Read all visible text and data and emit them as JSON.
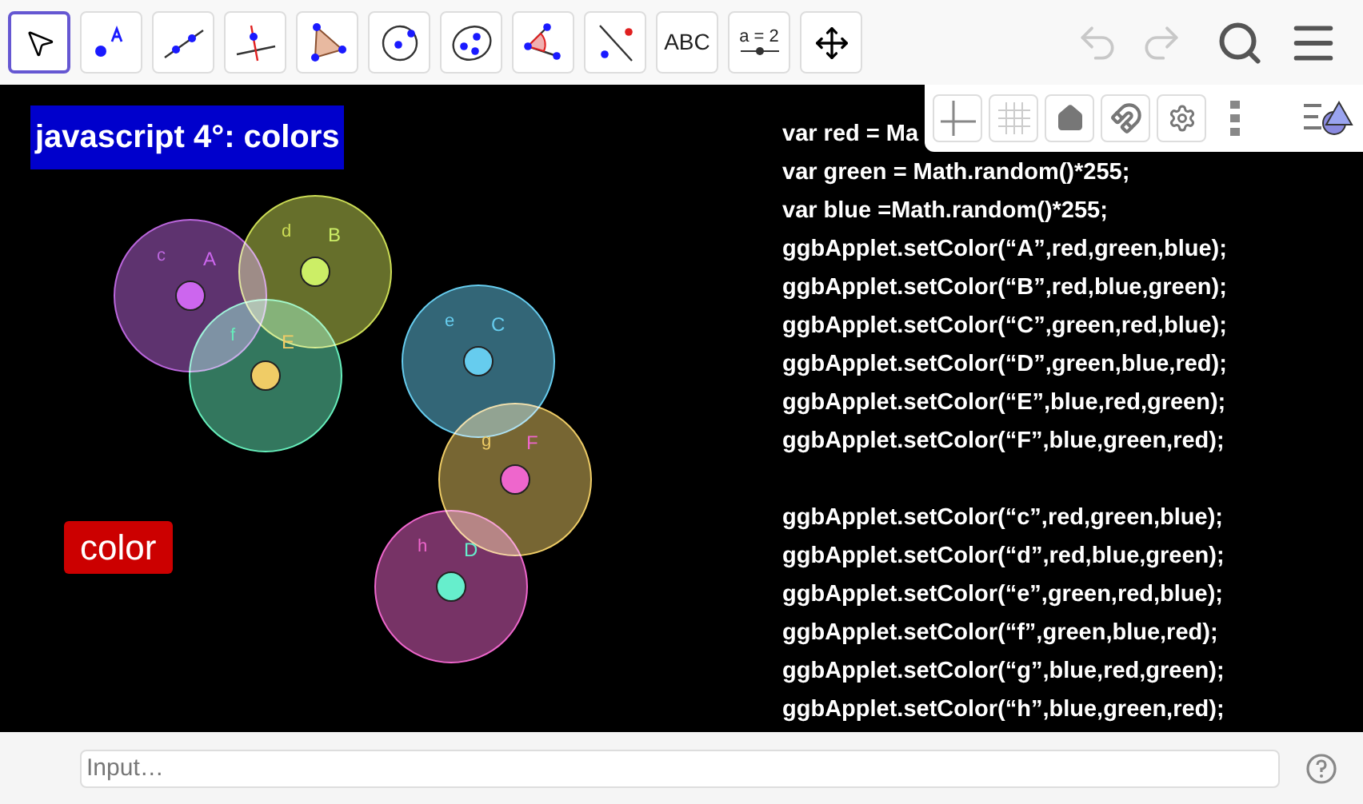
{
  "toolbar": {
    "tools": [
      {
        "kind": "pointer",
        "selected": true
      },
      {
        "kind": "point",
        "selected": false
      },
      {
        "kind": "line",
        "selected": false
      },
      {
        "kind": "perpendicular",
        "selected": false
      },
      {
        "kind": "polygon",
        "selected": false
      },
      {
        "kind": "circle",
        "selected": false
      },
      {
        "kind": "conic",
        "selected": false
      },
      {
        "kind": "angle",
        "selected": false
      },
      {
        "kind": "reflect",
        "selected": false
      },
      {
        "kind": "text",
        "label": "ABC",
        "selected": false
      },
      {
        "kind": "slider",
        "label": "a = 2",
        "selected": false
      },
      {
        "kind": "move",
        "selected": false
      }
    ],
    "undo": {
      "disabled": true
    },
    "redo": {
      "disabled": true
    }
  },
  "style_bar": {
    "buttons": [
      {
        "kind": "axes"
      },
      {
        "kind": "grid"
      },
      {
        "kind": "home"
      },
      {
        "kind": "magnet"
      },
      {
        "kind": "settings"
      },
      {
        "kind": "more"
      }
    ]
  },
  "canvas": {
    "title": "javascript 4°: colors",
    "button": "color",
    "circles": [
      {
        "label": "c",
        "color": "#bb66dd",
        "point": {
          "label": "A",
          "color": "#cc66ee"
        }
      },
      {
        "label": "d",
        "color": "#ccdd55",
        "point": {
          "label": "B",
          "color": "#ccee66"
        }
      },
      {
        "label": "f",
        "color": "#66eebb",
        "point": {
          "label": "E",
          "color": "#f0cc66"
        }
      },
      {
        "label": "e",
        "color": "#66ccee",
        "point": {
          "label": "C",
          "color": "#66ccee"
        }
      },
      {
        "label": "g",
        "color": "#eecc66",
        "point": {
          "label": "F",
          "color": "#ee66cc"
        }
      },
      {
        "label": "h",
        "color": "#ee66cc",
        "point": {
          "label": "D",
          "color": "#66eecc"
        }
      }
    ],
    "code_blocks": [
      {
        "lines": [
          "var red = Ma",
          "var green = Math.random()*255;",
          "var blue =Math.random()*255;",
          "ggbApplet.setColor(“A”,red,green,blue);",
          "ggbApplet.setColor(“B”,red,blue,green);",
          "ggbApplet.setColor(“C”,green,red,blue);",
          "ggbApplet.setColor(“D”,green,blue,red);",
          "ggbApplet.setColor(“E”,blue,red,green);",
          "ggbApplet.setColor(“F”,blue,green,red);"
        ]
      },
      {
        "lines": [
          "ggbApplet.setColor(“c”,red,green,blue);",
          "ggbApplet.setColor(“d”,red,blue,green);",
          "ggbApplet.setColor(“e”,green,red,blue);",
          "ggbApplet.setColor(“f”,green,blue,red);",
          "ggbApplet.setColor(“g”,blue,red,green);",
          "ggbApplet.setColor(“h”,blue,green,red);"
        ]
      }
    ]
  },
  "input_bar": {
    "placeholder": "Input…"
  }
}
